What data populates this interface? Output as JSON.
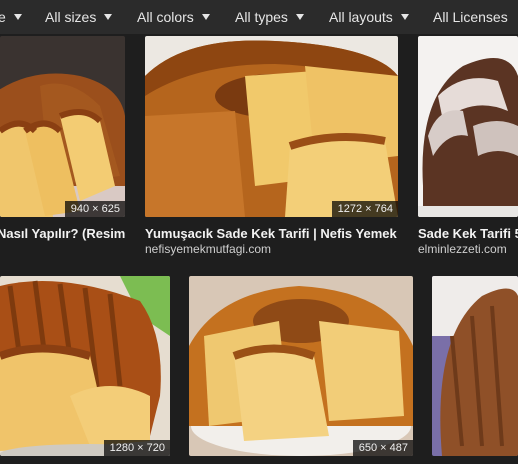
{
  "filters": [
    {
      "label": "e",
      "has_caret": true
    },
    {
      "label": "All sizes",
      "has_caret": true
    },
    {
      "label": "All colors",
      "has_caret": true
    },
    {
      "label": "All types",
      "has_caret": true
    },
    {
      "label": "All layouts",
      "has_caret": true
    },
    {
      "label": "All Licenses",
      "has_caret": false
    }
  ],
  "results": [
    {
      "dims": "940 × 625",
      "title": "Nasıl Yapılır? (Resiml...",
      "source": ""
    },
    {
      "dims": "1272 × 764",
      "title": "Yumuşacık Sade Kek Tarifi | Nefis Yemek ...",
      "source": "nefisyemekmutfagi.com"
    },
    {
      "dims": "",
      "title": "Sade Kek Tarifi 5",
      "source": "elminlezzeti.com"
    },
    {
      "dims": "1280 × 720",
      "title": "",
      "source": ""
    },
    {
      "dims": "650 × 487",
      "title": "",
      "source": ""
    },
    {
      "dims": "",
      "title": "",
      "source": ""
    }
  ],
  "colors": {
    "background": "#1e1e1e",
    "filter_bar": "#2b2b2b",
    "cake_crust": "#b5651d",
    "cake_crumb": "#f1c96b"
  }
}
